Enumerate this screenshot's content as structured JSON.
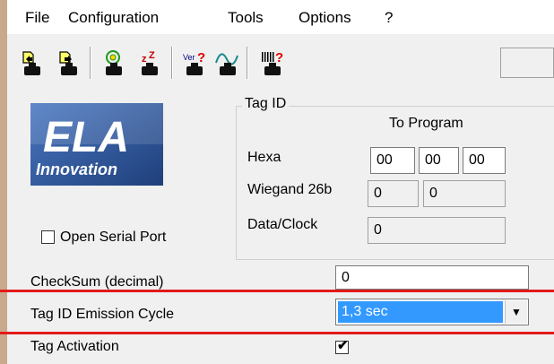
{
  "menu": {
    "items": [
      "File",
      "Configuration",
      "Tools",
      "Options",
      "?"
    ]
  },
  "toolbar": {
    "buttons": [
      {
        "icon": "read-from-reader-icon"
      },
      {
        "icon": "write-to-reader-icon"
      },
      {
        "icon": "antenna-signal-icon"
      },
      {
        "icon": "sleep-zz-icon"
      },
      {
        "icon": "version-query-icon",
        "text": "Ver"
      },
      {
        "icon": "waveform-icon"
      },
      {
        "icon": "barcode-query-icon"
      }
    ]
  },
  "logo": {
    "line1": "ELA",
    "line2": "Innovation"
  },
  "tag_id": {
    "title": "Tag ID",
    "column_header": "To Program",
    "hexa_label": "Hexa",
    "hexa_values": [
      "00",
      "00",
      "00"
    ],
    "wiegand_label": "Wiegand 26b",
    "wiegand_values": [
      "0",
      "0"
    ],
    "dataclock_label": "Data/Clock",
    "dataclock_value": "0"
  },
  "serial": {
    "label": "Open Serial Port",
    "checked": false
  },
  "checksum": {
    "label": "CheckSum (decimal)",
    "value": "0"
  },
  "emission": {
    "label": "Tag ID Emission Cycle",
    "value": "1,3 sec"
  },
  "activation": {
    "label": "Tag Activation",
    "checked": true,
    "check_glyph": "✔"
  },
  "colors": {
    "highlight": "#3399ff",
    "red_annotation": "#e31b1b",
    "logo_blue": "#2a4f8f"
  }
}
